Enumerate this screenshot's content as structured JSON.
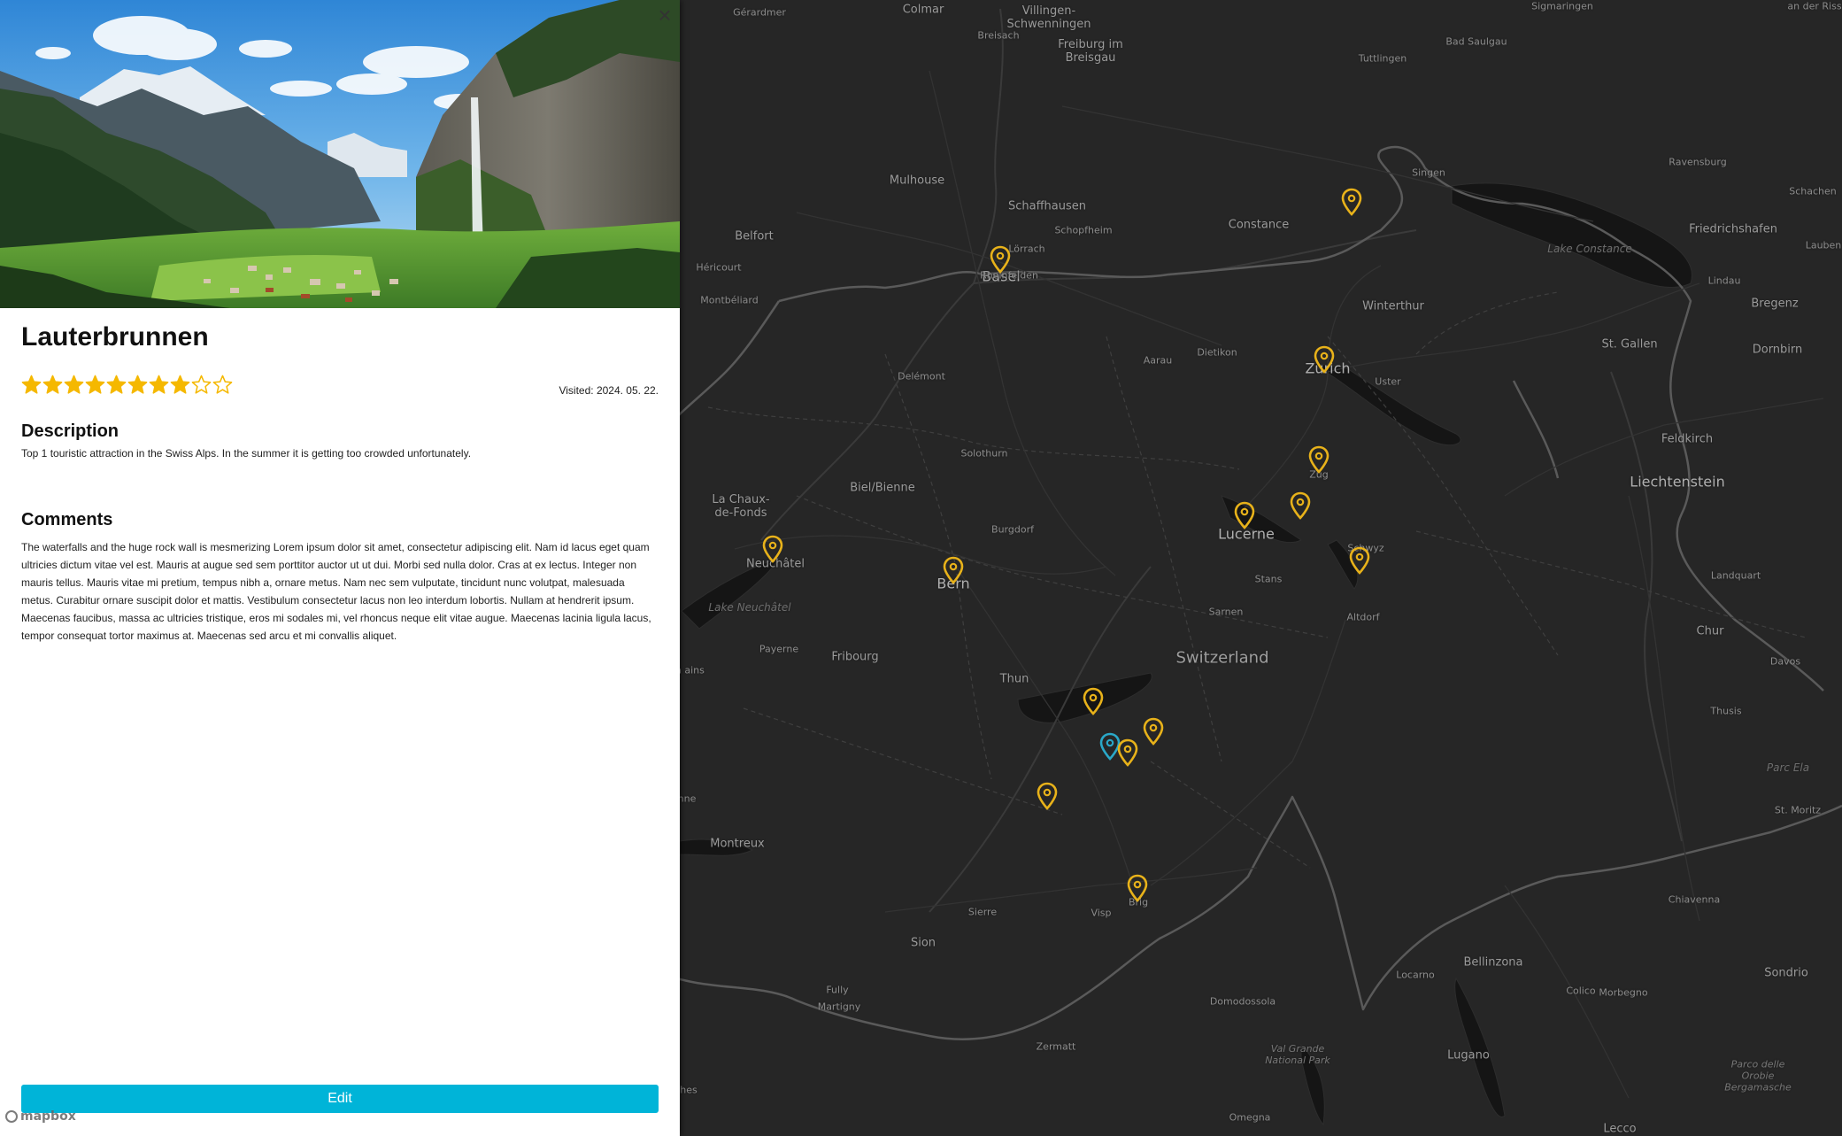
{
  "place": {
    "title": "Lauterbrunnen",
    "rating": 8,
    "rating_max": 10,
    "visited": "Visited: 2024. 05. 22.",
    "description_heading": "Description",
    "description": "Top 1 touristic attraction in the Swiss Alps. In the summer it is getting too crowded unfortunately.",
    "comments_heading": "Comments",
    "comments": "The waterfalls and the huge rock wall is mesmerizing Lorem ipsum dolor sit amet, consectetur adipiscing elit. Nam id lacus eget quam ultricies dictum vitae vel est. Mauris at augue sed sem porttitor auctor ut ut dui. Morbi sed nulla dolor. Cras at ex lectus. Integer non mauris tellus. Mauris vitae mi pretium, tempus nibh a, ornare metus. Nam nec sem vulputate, tincidunt nunc volutpat, malesuada metus. Curabitur ornare suscipit dolor et mattis. Vestibulum consectetur lacus non leo interdum lobortis. Nullam at hendrerit ipsum. Maecenas faucibus, massa ac ultricies tristique, eros mi sodales mi, vel rhoncus neque elit vitae augue. Maecenas lacinia ligula lacus, tempor consequat tortor maximus at. Maecenas sed arcu et mi convallis aliquet.",
    "close_icon": "close-icon",
    "edit_label": "Edit"
  },
  "attribution": {
    "logo_text": "mapbox"
  },
  "colors": {
    "accent": "#00b4d8",
    "star": "#f5b800",
    "marker": "#e8b21a",
    "marker_selected": "#2aa8c8",
    "map_bg": "#262626"
  },
  "map": {
    "labels": [
      {
        "text": "Gérardmer",
        "size": "s"
      },
      {
        "text": "Colmar",
        "size": "m"
      },
      {
        "text": "Villingen-Schwenningen",
        "size": "m"
      },
      {
        "text": "Sigmaringen",
        "size": "s"
      },
      {
        "text": "an der Riss",
        "size": "s"
      },
      {
        "text": "Breisach",
        "size": "s"
      },
      {
        "text": "Freiburg im Breisgau",
        "size": "m"
      },
      {
        "text": "Tuttlingen",
        "size": "s"
      },
      {
        "text": "Bad Saulgau",
        "size": "s"
      },
      {
        "text": "Mulhouse",
        "size": "m"
      },
      {
        "text": "Singen",
        "size": "s"
      },
      {
        "text": "Ravensburg",
        "size": "s"
      },
      {
        "text": "Schachen",
        "size": "s"
      },
      {
        "text": "Belfort",
        "size": "m"
      },
      {
        "text": "Schopfheim",
        "size": "s"
      },
      {
        "text": "Schaffhausen",
        "size": "m"
      },
      {
        "text": "Constance",
        "size": "m"
      },
      {
        "text": "Friedrichshafen",
        "size": "m"
      },
      {
        "text": "Lauben",
        "size": "s"
      },
      {
        "text": "Héricourt",
        "size": "s"
      },
      {
        "text": "Lörrach",
        "size": "s"
      },
      {
        "text": "Basel",
        "size": "l"
      },
      {
        "text": "Rheinfelden",
        "size": "s"
      },
      {
        "text": "Lake Constance",
        "size": "lake"
      },
      {
        "text": "Lindau",
        "size": "s"
      },
      {
        "text": "Bregenz",
        "size": "m"
      },
      {
        "text": "Montbéliard",
        "size": "s"
      },
      {
        "text": "Winterthur",
        "size": "m"
      },
      {
        "text": "Dornbirn",
        "size": "m"
      },
      {
        "text": "Dietikon",
        "size": "s"
      },
      {
        "text": "St. Gallen",
        "size": "m"
      },
      {
        "text": "Aarau",
        "size": "s"
      },
      {
        "text": "Zurich",
        "size": "l"
      },
      {
        "text": "Delémont",
        "size": "s"
      },
      {
        "text": "Uster",
        "size": "s"
      },
      {
        "text": "Solothurn",
        "size": "s"
      },
      {
        "text": "Feldkirch",
        "size": "m"
      },
      {
        "text": "Zug",
        "size": "s"
      },
      {
        "text": "Biel/Bienne",
        "size": "m"
      },
      {
        "text": "Liechtenstein",
        "size": "l"
      },
      {
        "text": "La Chaux-de-Fonds",
        "size": "m"
      },
      {
        "text": "Burgdorf",
        "size": "s"
      },
      {
        "text": "Lucerne",
        "size": "l"
      },
      {
        "text": "Schwyz",
        "size": "s"
      },
      {
        "text": "Neuchâtel",
        "size": "m"
      },
      {
        "text": "Bern",
        "size": "l"
      },
      {
        "text": "Stans",
        "size": "s"
      },
      {
        "text": "Landquart",
        "size": "s"
      },
      {
        "text": "Lake Neuchâtel",
        "size": "lake"
      },
      {
        "text": "Sarnen",
        "size": "s"
      },
      {
        "text": "Altdorf",
        "size": "s"
      },
      {
        "text": "Chur",
        "size": "m"
      },
      {
        "text": "Payerne",
        "size": "s"
      },
      {
        "text": "Fribourg",
        "size": "m"
      },
      {
        "text": "Switzerland",
        "size": "country"
      },
      {
        "text": "Davos",
        "size": "s"
      },
      {
        "text": "Thun",
        "size": "m"
      },
      {
        "text": "Thusis",
        "size": "s"
      },
      {
        "text": "Parc Ela",
        "size": "lake"
      },
      {
        "text": "Montreux",
        "size": "m"
      },
      {
        "text": "St. Moritz",
        "size": "s"
      },
      {
        "text": "Chiavenna",
        "size": "s"
      },
      {
        "text": "Sierre",
        "size": "s"
      },
      {
        "text": "Visp",
        "size": "s"
      },
      {
        "text": "Brig",
        "size": "s"
      },
      {
        "text": "Sion",
        "size": "m"
      },
      {
        "text": "Bellinzona",
        "size": "m"
      },
      {
        "text": "Locarno",
        "size": "s"
      },
      {
        "text": "Sondrio",
        "size": "m"
      },
      {
        "text": "Fully",
        "size": "s"
      },
      {
        "text": "Colico",
        "size": "s"
      },
      {
        "text": "Morbegno",
        "size": "s"
      },
      {
        "text": "Martigny",
        "size": "s"
      },
      {
        "text": "Domodossola",
        "size": "s"
      },
      {
        "text": "Zermatt",
        "size": "s"
      },
      {
        "text": "Val Grande National Park",
        "size": "park"
      },
      {
        "text": "Lugano",
        "size": "m"
      },
      {
        "text": "Parco delle Orobie Bergamasche",
        "size": "park"
      },
      {
        "text": "Omegna",
        "size": "s"
      },
      {
        "text": "Lecco",
        "size": "m"
      },
      {
        "text": "nne",
        "size": "s"
      },
      {
        "text": "on\nains",
        "size": "s"
      },
      {
        "text": "hes",
        "size": "s"
      }
    ],
    "markers": [
      {
        "name": "marker-schaffhausen",
        "selected": false
      },
      {
        "name": "marker-basel",
        "selected": false
      },
      {
        "name": "marker-zurich",
        "selected": false
      },
      {
        "name": "marker-zug",
        "selected": false
      },
      {
        "name": "marker-lucerne",
        "selected": false
      },
      {
        "name": "marker-rigi",
        "selected": false
      },
      {
        "name": "marker-schwyz",
        "selected": false
      },
      {
        "name": "marker-neuchatel",
        "selected": false
      },
      {
        "name": "marker-bern",
        "selected": false
      },
      {
        "name": "marker-interlaken",
        "selected": false
      },
      {
        "name": "marker-grindelwald",
        "selected": false
      },
      {
        "name": "marker-lauterbrunnen",
        "selected": true
      },
      {
        "name": "marker-wengen",
        "selected": false
      },
      {
        "name": "marker-kandersteg",
        "selected": false
      },
      {
        "name": "marker-brig",
        "selected": false
      }
    ]
  }
}
